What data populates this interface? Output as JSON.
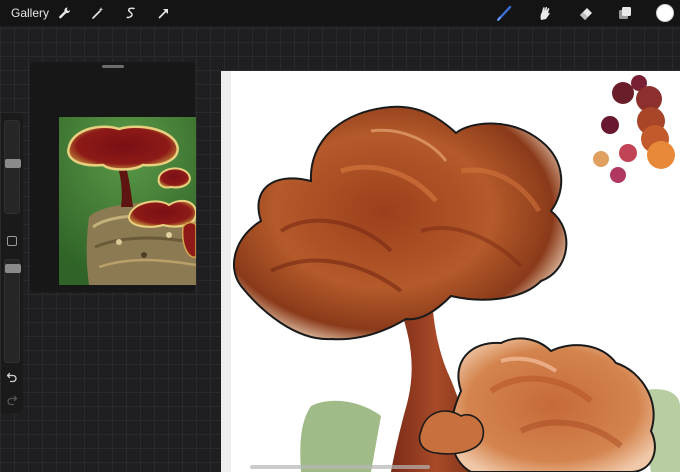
{
  "toolbar": {
    "gallery_label": "Gallery",
    "left_tools": [
      "wrench-icon",
      "magic-wand-icon",
      "selection-icon",
      "transform-arrow-icon"
    ],
    "right_tools": [
      "brush-icon",
      "smudge-icon",
      "eraser-icon",
      "layers-icon"
    ],
    "active_tool": "brush-icon",
    "accent_color": "#3a6fd8",
    "current_color": "#ffffff"
  },
  "sidebar": {
    "brush_size_slider": 0.79,
    "opacity_slider": 0.97,
    "undo_icon": "undo-icon",
    "redo_icon": "redo-icon"
  },
  "reference_panel": {
    "image_subject": "reishi-mushroom-photo"
  },
  "canvas": {
    "background": "#ffffff",
    "palette_colors": [
      "#6a1e2a",
      "#8c2f2d",
      "#a84529",
      "#c25a2b",
      "#d8682b",
      "#e8893a",
      "#7a2035",
      "#c04455",
      "#e0a060"
    ]
  }
}
